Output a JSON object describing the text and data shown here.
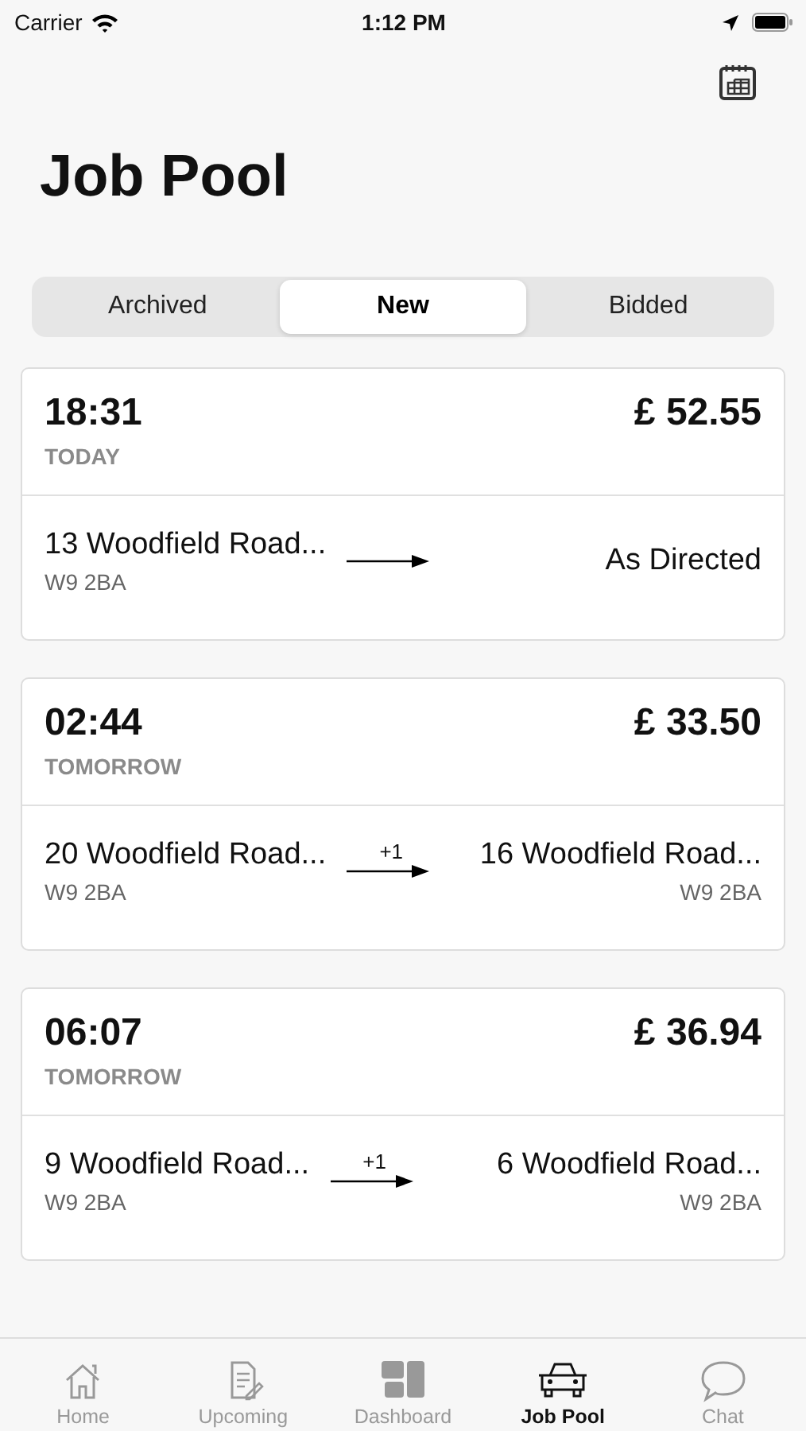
{
  "status_bar": {
    "carrier": "Carrier",
    "time": "1:12 PM"
  },
  "title": "Job Pool",
  "segments": [
    {
      "label": "Archived",
      "selected": false
    },
    {
      "label": "New",
      "selected": true
    },
    {
      "label": "Bidded",
      "selected": false
    }
  ],
  "jobs": [
    {
      "time": "18:31",
      "day": "TODAY",
      "price": "£ 52.55",
      "from": {
        "address": "13 Woodfield Road...",
        "postcode": "W9 2BA"
      },
      "to": {
        "address": "As Directed"
      }
    },
    {
      "time": "02:44",
      "day": "TOMORROW",
      "price": "£ 33.50",
      "from": {
        "address": "20 Woodfield Road...",
        "postcode": "W9 2BA"
      },
      "stops": "+1",
      "to": {
        "address": "16 Woodfield Road...",
        "postcode": "W9 2BA"
      }
    },
    {
      "time": "06:07",
      "day": "TOMORROW",
      "price": "£ 36.94",
      "from": {
        "address": "9 Woodfield Road...",
        "postcode": "W9 2BA"
      },
      "stops": "+1",
      "to": {
        "address": "6 Woodfield Road...",
        "postcode": "W9 2BA"
      }
    }
  ],
  "tab_bar": [
    {
      "label": "Home",
      "kind": "home",
      "selected": false
    },
    {
      "label": "Upcoming",
      "kind": "upcoming",
      "selected": false
    },
    {
      "label": "Dashboard",
      "kind": "dashboard",
      "selected": false
    },
    {
      "label": "Job Pool",
      "kind": "car",
      "selected": true
    },
    {
      "label": "Chat",
      "kind": "chat",
      "selected": false
    }
  ]
}
